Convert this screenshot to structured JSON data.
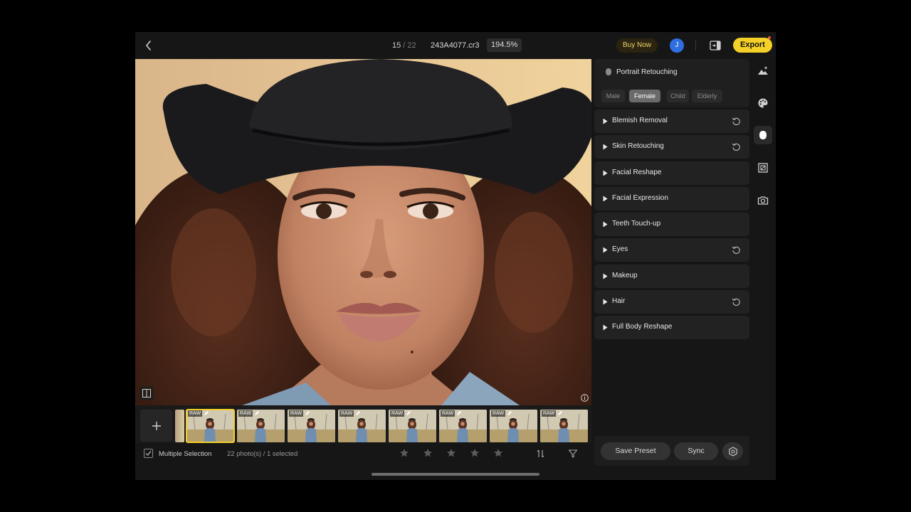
{
  "topbar": {
    "back_icon": "chevron-left-icon",
    "photo_index": "15",
    "photo_separator": " / ",
    "photo_total": "22",
    "filename": "243A4077.cr3",
    "zoom": "194.5%",
    "buy_now": "Buy Now",
    "avatar_initial": "J",
    "export": "Export"
  },
  "filmstrip": {
    "raw_badge": "RAW",
    "thumbnails": 8,
    "selected_index": 0
  },
  "bottombar": {
    "multiple_selection": "Multiple Selection",
    "count": "22 photo(s) / 1 selected",
    "rating_stars": 5,
    "rating_value": 0
  },
  "panel": {
    "title": "Portrait Retouching",
    "segments": [
      "Male",
      "Female",
      "Child",
      "Elderly"
    ],
    "active_segment": "Female",
    "sections": [
      {
        "label": "Blemish Removal",
        "reset": true
      },
      {
        "label": "Skin Retouching",
        "reset": true
      },
      {
        "label": "Facial Reshape",
        "reset": false
      },
      {
        "label": "Facial Expression",
        "reset": false
      },
      {
        "label": "Teeth Touch-up",
        "reset": false
      },
      {
        "label": "Eyes",
        "reset": true
      },
      {
        "label": "Makeup",
        "reset": false
      },
      {
        "label": "Hair",
        "reset": true
      },
      {
        "label": "Full Body Reshape",
        "reset": false
      }
    ],
    "save_preset": "Save Preset",
    "sync": "Sync"
  },
  "rail": {
    "tools": [
      "ai-scene-icon",
      "palette-icon",
      "face-retouch-icon",
      "crop-icon",
      "camera-icon"
    ],
    "active_tool": "face-retouch-icon"
  },
  "colors": {
    "accent": "#f5d028",
    "avatar": "#2f6ee0",
    "background": "#161616"
  }
}
